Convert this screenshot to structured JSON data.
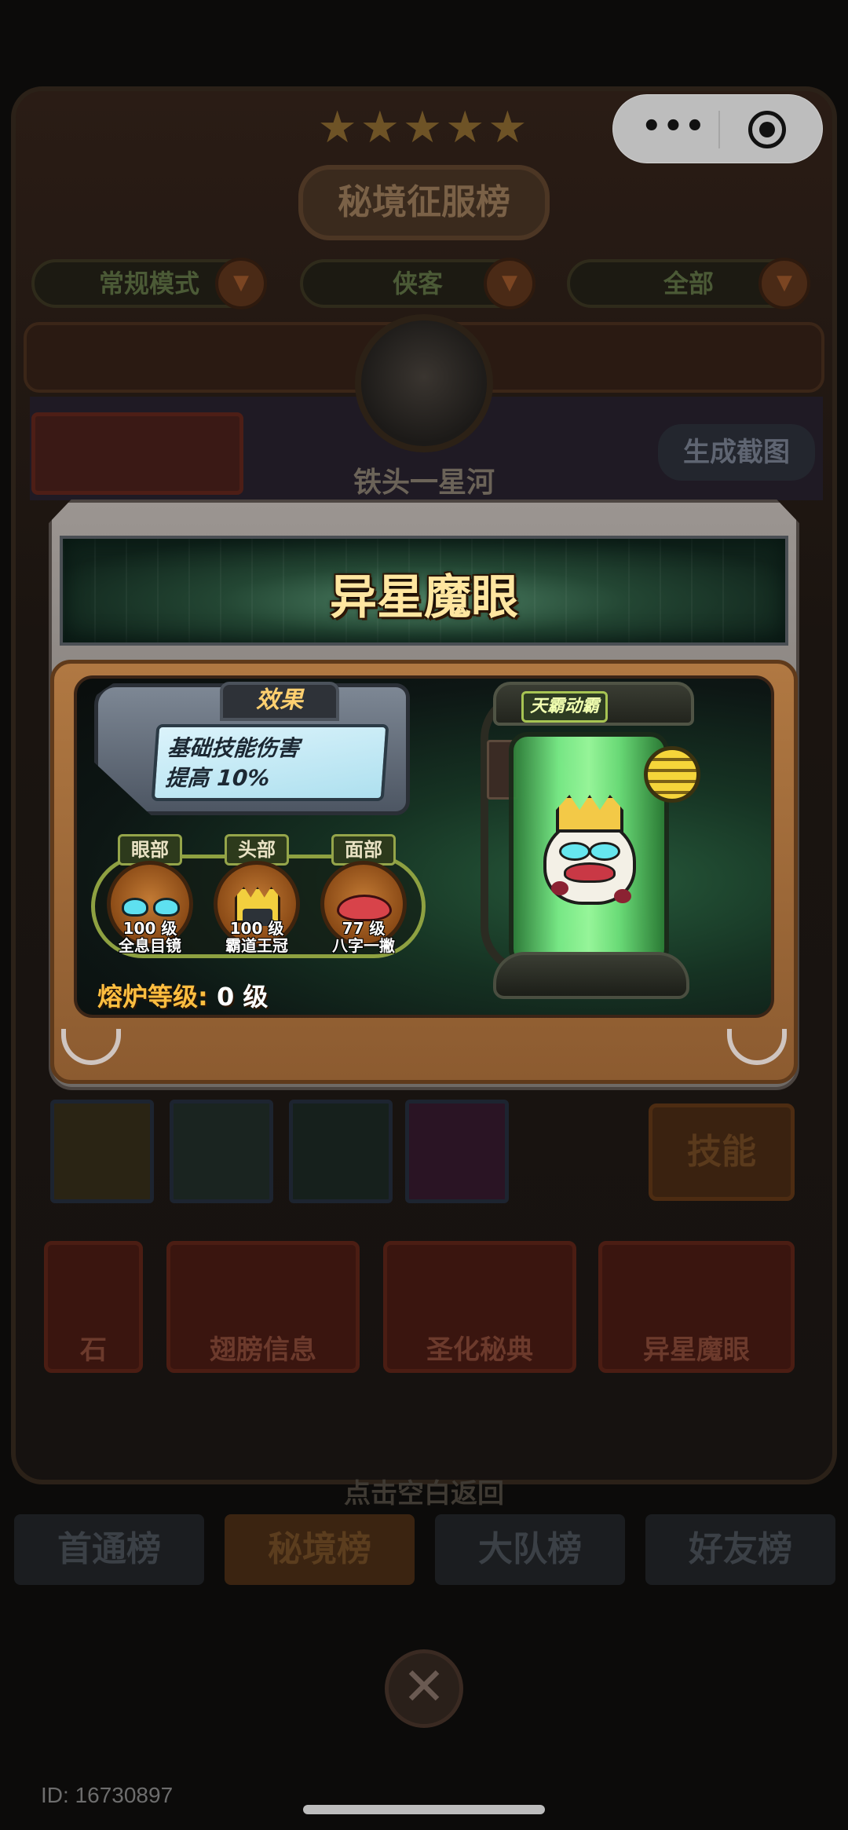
{
  "background": {
    "page_title": "秘境征服榜",
    "filters": [
      {
        "label": "常规模式"
      },
      {
        "label": "侠客"
      },
      {
        "label": "全部"
      }
    ],
    "player_name": "铁头一星河",
    "screenshot_button": "生成截图",
    "skills_button": "技能",
    "info_tabs": [
      "石",
      "翅膀信息",
      "圣化秘典",
      "异星魔眼"
    ],
    "back_hint": "点击空白返回",
    "rank_tabs": [
      {
        "label": "首通榜",
        "active": false
      },
      {
        "label": "秘境榜",
        "active": true
      },
      {
        "label": "大队榜",
        "active": false
      },
      {
        "label": "好友榜",
        "active": false
      }
    ],
    "user_id": "ID: 16730897"
  },
  "capsule": {
    "more_icon": "more-dots-icon",
    "close_icon": "target-circle-icon"
  },
  "modal": {
    "title": "异星魔眼",
    "effect": {
      "tab_label": "效果",
      "line1": "基础技能伤害",
      "line2": "提高 10%"
    },
    "slots": [
      {
        "part": "眼部",
        "level": "100 级",
        "name": "全息目镜",
        "icon": "holo-glasses-icon"
      },
      {
        "part": "头部",
        "level": "100 级",
        "name": "霸道王冠",
        "icon": "crown-icon"
      },
      {
        "part": "面部",
        "level": "77 级",
        "name": "八字一撇",
        "icon": "mustache-icon"
      }
    ],
    "furnace_label": "熔炉等级:",
    "furnace_value": "0 级",
    "character_badge": "天霸动霸"
  },
  "colors": {
    "title_gold": "#ffe6a0",
    "furnace_label": "#ffbe40",
    "tube_green": "#7cf08a",
    "panel_brown": "#8c5b30"
  }
}
